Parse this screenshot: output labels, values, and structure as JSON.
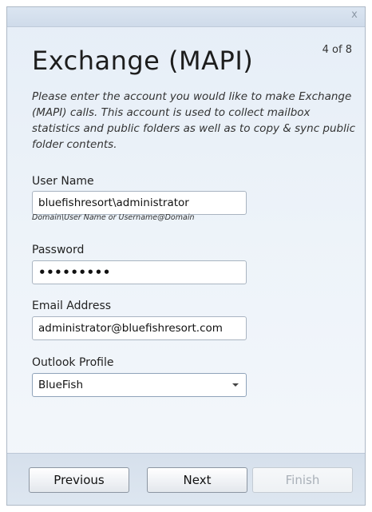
{
  "dialog": {
    "close_glyph": "x",
    "title": "Exchange (MAPI)",
    "step": "4 of 8",
    "description": "Please enter the account you would like to make Exchange (MAPI) calls. This account is used to collect mailbox statistics and public folders as well as to copy & sync public folder contents."
  },
  "form": {
    "username": {
      "label": "User Name",
      "value": "bluefishresort\\administrator",
      "hint": "Domain\\User Name or Username@Domain"
    },
    "password": {
      "label": "Password",
      "masked_value": "•••••••••"
    },
    "email": {
      "label": "Email Address",
      "value": "administrator@bluefishresort.com"
    },
    "outlook_profile": {
      "label": "Outlook Profile",
      "selected": "BlueFish"
    }
  },
  "buttons": {
    "previous": "Previous",
    "next": "Next",
    "finish": "Finish"
  }
}
